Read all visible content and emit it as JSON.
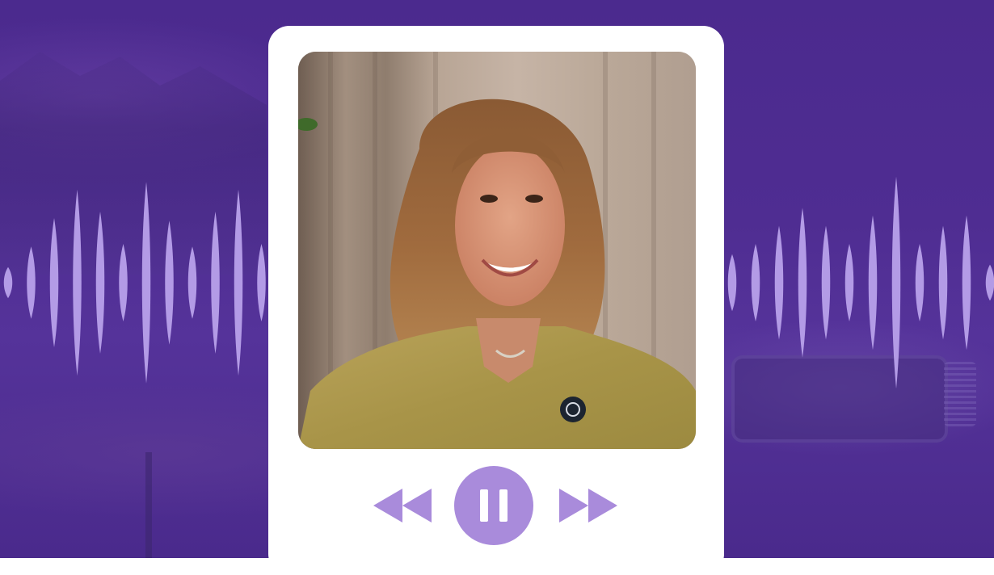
{
  "colors": {
    "background": "#4b2a8e",
    "wave": "#b39be6",
    "card": "#ffffff",
    "control_accent": "#a98bdb"
  },
  "waveform": {
    "left_bar_levels": [
      0.12,
      0.28,
      0.5,
      0.72,
      0.55,
      0.3,
      0.78,
      0.48,
      0.28,
      0.55,
      0.72,
      0.3
    ],
    "right_bar_levels": [
      0.22,
      0.3,
      0.44,
      0.58,
      0.44,
      0.3,
      0.52,
      0.82,
      0.3,
      0.44,
      0.52,
      0.14
    ]
  },
  "player": {
    "state": "playing",
    "controls": [
      {
        "name": "rewind",
        "icon": "rewind-icon"
      },
      {
        "name": "pause",
        "icon": "pause-icon"
      },
      {
        "name": "fast-forward",
        "icon": "fast-forward-icon"
      }
    ]
  },
  "artwork": {
    "icon": "guest-portrait"
  }
}
